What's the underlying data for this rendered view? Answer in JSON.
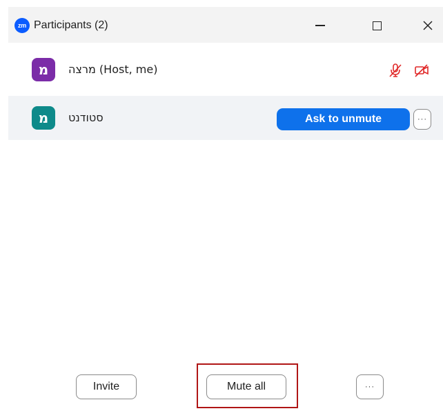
{
  "window": {
    "app_logo_text": "zm",
    "title": "Participants (2)"
  },
  "participants": [
    {
      "avatar_letter": "מ",
      "avatar_color": "#7b2ca8",
      "name": "מרצה (Host, me)",
      "mic": "muted-mic-icon",
      "video": "video-off-icon"
    },
    {
      "avatar_letter": "מ",
      "avatar_color": "#0e8a8a",
      "name": "סטודנט",
      "action_label": "Ask to unmute",
      "more_label": "···"
    }
  ],
  "footer": {
    "invite_label": "Invite",
    "mute_all_label": "Mute all",
    "more_label": "···"
  },
  "colors": {
    "accent": "#0e71eb",
    "muted_red": "#e02828",
    "highlight": "#b01515"
  }
}
